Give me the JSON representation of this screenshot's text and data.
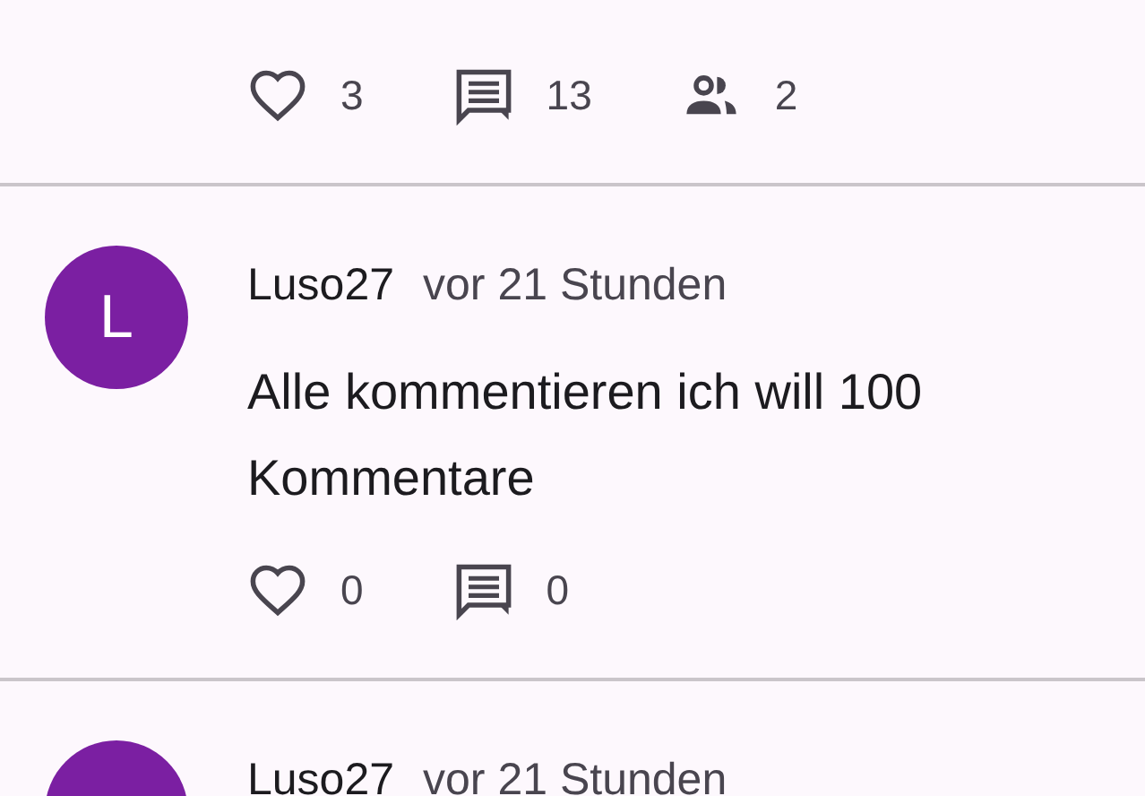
{
  "posts": [
    {
      "actions": [
        {
          "kind": "like",
          "count": "3"
        },
        {
          "kind": "comment",
          "count": "13"
        },
        {
          "kind": "participants",
          "count": "2"
        }
      ]
    },
    {
      "avatar_letter": "L",
      "author": "Luso27",
      "time": "vor 21 Stunden",
      "text": "Alle kommentieren ich will 100 Kommentare",
      "actions": [
        {
          "kind": "like",
          "count": "0"
        },
        {
          "kind": "comment",
          "count": "0"
        }
      ]
    },
    {
      "author": "Luso27",
      "time": "vor 21 Stunden"
    }
  ]
}
